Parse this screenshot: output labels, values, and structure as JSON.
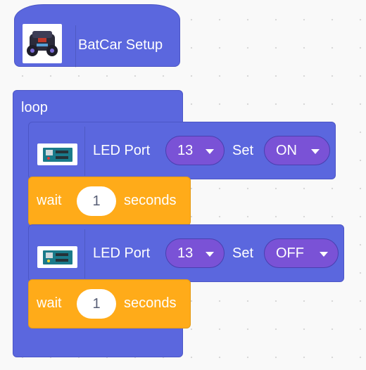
{
  "setup": {
    "label": "BatCar Setup",
    "thumb_icon": "robot-car-image"
  },
  "loop": {
    "label": "loop"
  },
  "led_blocks": [
    {
      "label": "LED Port",
      "port": "13",
      "set_label": "Set",
      "state": "ON",
      "board_icon": "arduino-board-image"
    },
    {
      "label": "LED Port",
      "port": "13",
      "set_label": "Set",
      "state": "OFF",
      "board_icon": "arduino-board-image"
    }
  ],
  "wait_blocks": [
    {
      "label": "wait",
      "value": "1",
      "unit": "seconds"
    },
    {
      "label": "wait",
      "value": "1",
      "unit": "seconds"
    }
  ],
  "colors": {
    "motion_blue": "#5b67de",
    "dropdown_purple": "#7a52d6",
    "control_orange": "#ffab19",
    "canvas_bg": "#f9f9f9"
  }
}
